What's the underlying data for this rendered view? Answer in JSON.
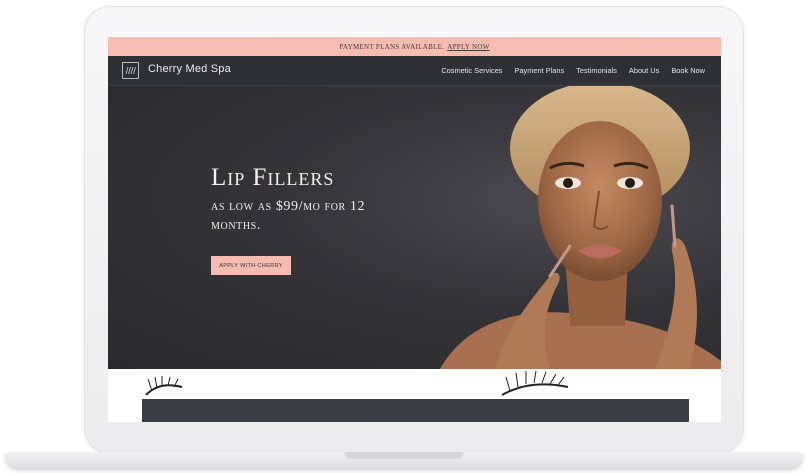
{
  "promo_bar": {
    "text": "Payment plans available.",
    "link": "Apply now"
  },
  "nav": {
    "brand": "Cherry Med Spa",
    "logo_icon": "wave-lines-icon",
    "items": [
      "Cosmetic Services",
      "Payment Plans",
      "Testimonials",
      "About Us",
      "Book Now"
    ]
  },
  "hero": {
    "title": "Lip Fillers",
    "subtitle": "as low as $99/mo for 12 months.",
    "cta": "Apply with Cherry"
  },
  "colors": {
    "accent_pink": "#f6bcb2",
    "nav_dark": "#2f3036",
    "hero_dark": "#2d2d31"
  }
}
